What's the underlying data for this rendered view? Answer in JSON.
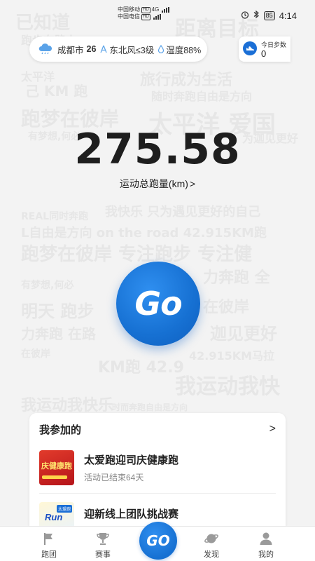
{
  "status_bar": {
    "carrier_1": "中国移动",
    "carrier_2": "中国电信",
    "carrier_tag": "HD",
    "network": "4G",
    "battery": "85",
    "time": "4:14"
  },
  "watermark": [
    "已知道",
    "跑步在路上",
    "跑出自我",
    "距离目标",
    "太平洋",
    "旅行成为生活",
    "己 KM 跑",
    "随时奔跑自由是方向",
    "跑梦在彼岸",
    "太平洋 爱国",
    "有梦想,何必",
    "为迦见更好",
    "我快乐 只为遇见更好的自己",
    "REAL同时奔跑",
    "L自由是方向 on the road 42.915KM跑",
    "跑梦在彼岸 专注跑步 专注健",
    "力奔跑 全",
    "有梦想,何必",
    "明天 跑步",
    "在彼岸",
    "力奔跑 在路",
    "迦见更好",
    "在彼岸",
    "42.915KM马拉",
    "我运动我快",
    "KM跑 42.9",
    "时而奔跑自由是方向",
    "我运动我快乐"
  ],
  "weather": {
    "city": "成都市",
    "temperature": "26",
    "wind": "东北风≤3级",
    "humidity": "湿度88%"
  },
  "steps": {
    "label": "今日步数",
    "value": "0"
  },
  "distance": {
    "value": "275.58",
    "label": "运动总跑量(km)",
    "chevron": ">"
  },
  "go_button": {
    "label": "Go"
  },
  "my_events": {
    "title": "我参加的",
    "arrow": ">",
    "items": [
      {
        "title": "太爱跑迎司庆健康跑",
        "status": "活动已结束64天",
        "thumb_text": "庆健康跑"
      },
      {
        "title": "迎新线上团队挑战赛",
        "status": "",
        "thumb_badge": "太爱跑",
        "thumb_text": "Run"
      }
    ]
  },
  "nav": {
    "items": [
      {
        "label": "跑团",
        "icon": "flag-icon"
      },
      {
        "label": "赛事",
        "icon": "trophy-icon"
      },
      {
        "label": "发现",
        "icon": "planet-icon"
      },
      {
        "label": "我的",
        "icon": "user-icon"
      }
    ],
    "go_label": "GO"
  },
  "colors": {
    "accent": "#1670d2",
    "background": "#f3f3f3"
  }
}
